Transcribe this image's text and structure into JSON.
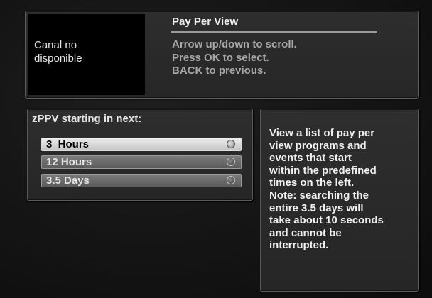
{
  "top_panel": {
    "channel_message": "Canal no\ndisponible",
    "title": "Pay Per View",
    "instructions": [
      "Arrow up/down to scroll.",
      "Press OK to select.",
      "BACK to previous."
    ]
  },
  "left_panel": {
    "title": "zPPV starting in next:",
    "options": [
      {
        "label": "3  Hours",
        "selected": true
      },
      {
        "label": "12 Hours",
        "selected": false
      },
      {
        "label": "3.5 Days",
        "selected": false
      }
    ]
  },
  "right_panel": {
    "description_lines": [
      "View a list of pay per",
      "view programs and",
      "events that start",
      "within the predefined",
      "times on the left.",
      "Note: searching the",
      "entire 3.5 days will",
      "take about 10 seconds",
      "and cannot be",
      "interrupted."
    ]
  },
  "colors": {
    "background": "#141414",
    "panel": "#2a2a2a",
    "selected_option": "#d8d8d8",
    "option": "#6a6a6a"
  }
}
